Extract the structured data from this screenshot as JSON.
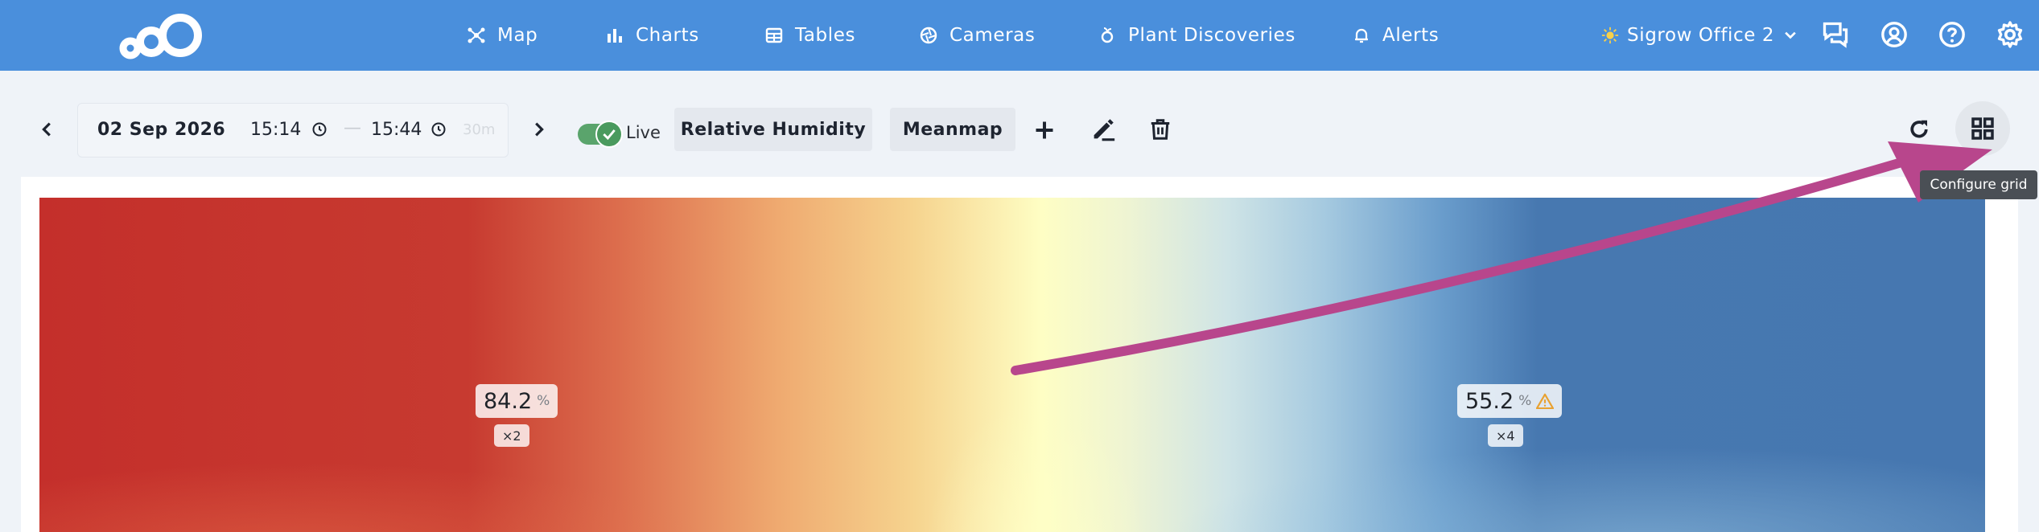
{
  "nav": {
    "items": [
      {
        "label": "Map",
        "icon": "map-network-icon"
      },
      {
        "label": "Charts",
        "icon": "bar-chart-icon"
      },
      {
        "label": "Tables",
        "icon": "table-icon"
      },
      {
        "label": "Cameras",
        "icon": "camera-aperture-icon"
      },
      {
        "label": "Plant Discoveries",
        "icon": "plant-icon"
      },
      {
        "label": "Alerts",
        "icon": "bell-icon"
      }
    ],
    "office": "Sigrow Office 2"
  },
  "toolbar": {
    "date": "02 Sep 2026",
    "time_start": "15:14",
    "dash": "—",
    "time_end": "15:44",
    "duration": "30m",
    "live_label": "Live",
    "live_on": true,
    "metric": "Relative Humidity",
    "view": "Meanmap",
    "tooltip": "Configure grid"
  },
  "heatmap": {
    "zones": [
      {
        "value": "84.2",
        "unit": "%",
        "count": "×2",
        "warning": false
      },
      {
        "value": "55.2",
        "unit": "%",
        "count": "×4",
        "warning": true
      }
    ]
  },
  "colors": {
    "nav_bg": "#4a8fdc",
    "humid_high": "#c42f2b",
    "humid_low": "#4677b0",
    "toggle_on": "#5aa46c",
    "annotation_arrow": "#b8468c"
  }
}
